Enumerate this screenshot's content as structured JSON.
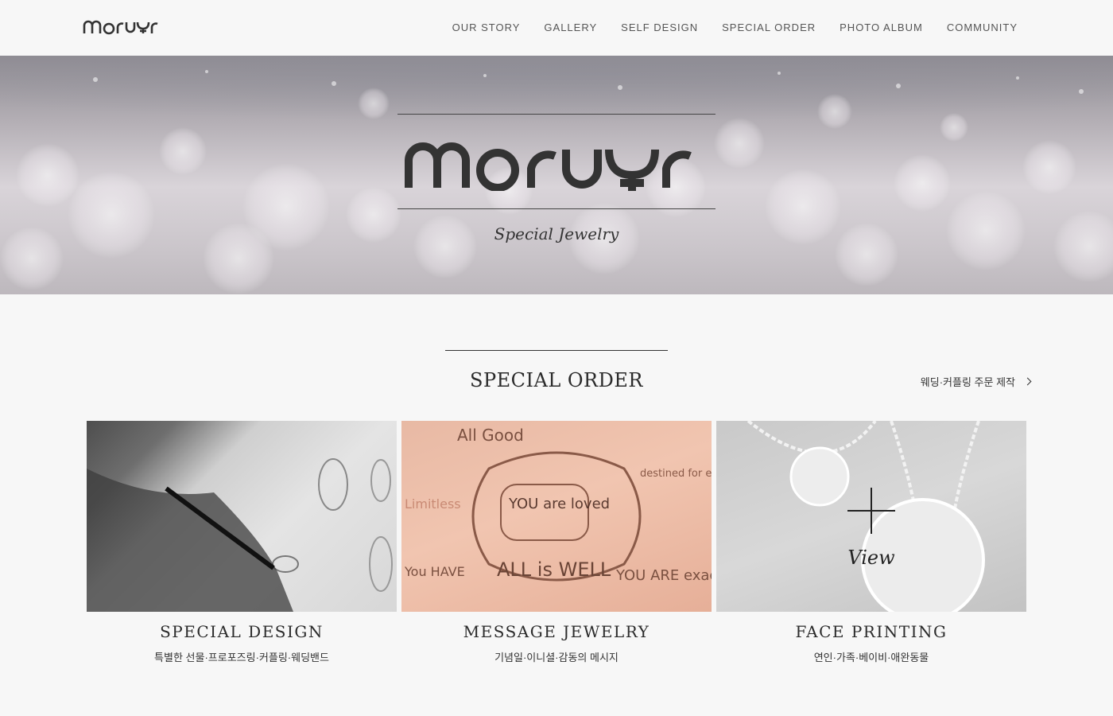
{
  "brand": {
    "name": "moruyr",
    "logo_icon": "moruyr-logo"
  },
  "nav": {
    "items": [
      {
        "label": "OUR STORY"
      },
      {
        "label": "GALLERY"
      },
      {
        "label": "SELF DESIGN"
      },
      {
        "label": "SPECIAL ORDER"
      },
      {
        "label": "PHOTO ALBUM"
      },
      {
        "label": "COMMUNITY"
      }
    ]
  },
  "hero": {
    "tagline": "Special Jewelry"
  },
  "section": {
    "title": "SPECIAL ORDER",
    "link_label": "웨딩·커플링 주문 제작",
    "link_icon": "chevron-right-icon"
  },
  "cards": [
    {
      "title": "SPECIAL DESIGN",
      "subtitle": "특별한 선물·프로포즈링·커플링·웨딩밴드"
    },
    {
      "title": "MESSAGE JEWELRY",
      "subtitle": "기념일·이니셜·감동의 메시지",
      "artwork_text": [
        "YOU are loved",
        "ALL is WELL",
        "YOU ARE exactly",
        "All Good",
        "Limitless",
        "You HAVE",
        "destined for even GREATER things"
      ]
    },
    {
      "title": "FACE PRINTING",
      "subtitle": "연인·가족·베이비·애완동물",
      "overlay_label": "View"
    }
  ],
  "colors": {
    "background": "#f7f7f7",
    "text": "#333333",
    "nav_text": "#555555",
    "card_peach": "#f1c5b0"
  }
}
